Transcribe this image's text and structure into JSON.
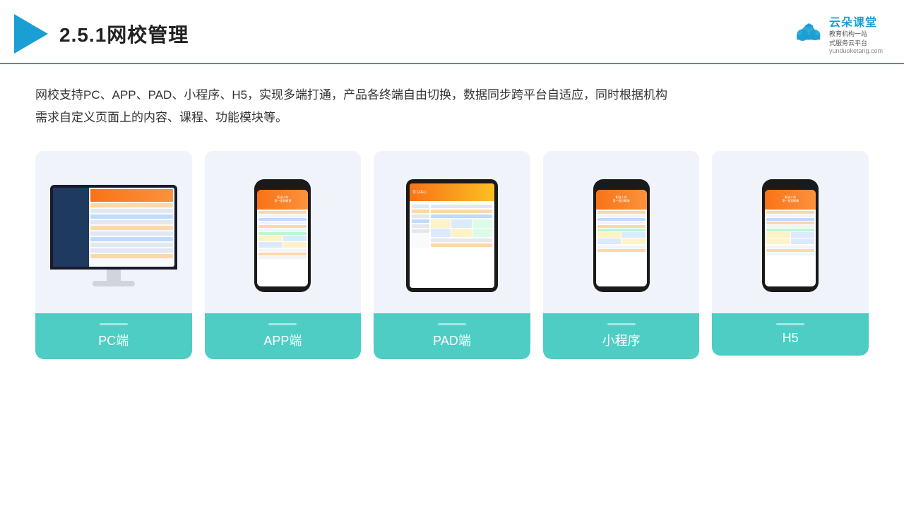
{
  "header": {
    "page_number": "2.5.1",
    "page_title": "网校管理",
    "brand_name": "云朵课堂",
    "brand_url": "yunduoketang.com",
    "brand_tagline_line1": "教育机构一站",
    "brand_tagline_line2": "式服务云平台"
  },
  "description": {
    "text": "网校支持PC、APP、PAD、小程序、H5，实现多端打通，产品各终端自由切换，数据同步跨平台自适应，同时根据机构需求自定义页面上的内容、课程、功能模块等。"
  },
  "devices": [
    {
      "id": "pc",
      "label": "PC端",
      "type": "monitor"
    },
    {
      "id": "app",
      "label": "APP端",
      "type": "phone"
    },
    {
      "id": "pad",
      "label": "PAD端",
      "type": "tablet"
    },
    {
      "id": "miniapp",
      "label": "小程序",
      "type": "phone"
    },
    {
      "id": "h5",
      "label": "H5",
      "type": "phone"
    }
  ],
  "colors": {
    "accent": "#4ecdc4",
    "header_line": "#1a9fd4",
    "text": "#333333"
  }
}
